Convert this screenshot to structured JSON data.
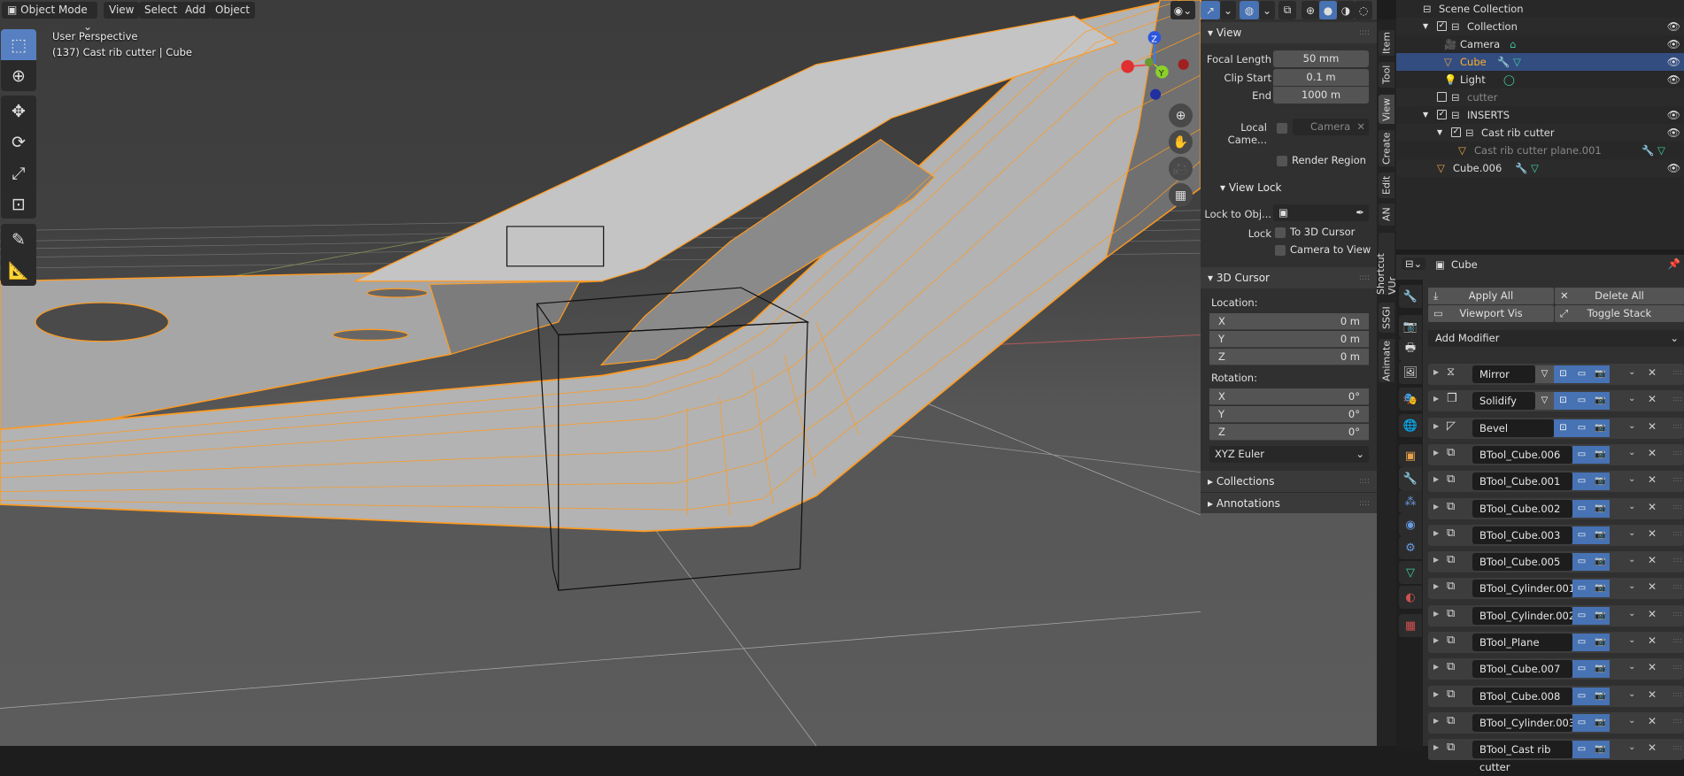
{
  "colors": {
    "accent": "#4772b3",
    "selection": "#334d80",
    "wire": "#ff9a1f",
    "active_object": "#e8a14a"
  },
  "viewport": {
    "header": {
      "mode": "Object Mode",
      "menus": [
        "View",
        "Select",
        "Add",
        "Object"
      ]
    },
    "overlay": {
      "line1": "User Perspective",
      "line2": "(137) Cast rib cutter | Cube"
    },
    "gizmo": {
      "z": "Z",
      "y": "Y"
    },
    "tools": [
      "select-box",
      "cursor",
      "move",
      "rotate",
      "scale",
      "transform",
      "annotate",
      "measure"
    ],
    "header_icons": [
      "visibility",
      "gizmo",
      "overlays",
      "xray",
      "shading-wireframe",
      "shading-solid",
      "shading-material",
      "shading-rendered"
    ]
  },
  "npanel": {
    "view": {
      "title": "View",
      "focal_length_label": "Focal Length",
      "focal_length": "50 mm",
      "clip_start_label": "Clip Start",
      "clip_start": "0.1 m",
      "end_label": "End",
      "end": "1000 m",
      "local_camera_label": "Local Came...",
      "camera_placeholder": "Camera",
      "render_region": "Render Region"
    },
    "view_lock": {
      "title": "View Lock",
      "lock_to_obj_label": "Lock to Obj...",
      "lock_label": "Lock",
      "to_3d_cursor": "To 3D Cursor",
      "camera_to_view": "Camera to View"
    },
    "cursor": {
      "title": "3D Cursor",
      "location_label": "Location:",
      "loc": [
        [
          "X",
          "0 m"
        ],
        [
          "Y",
          "0 m"
        ],
        [
          "Z",
          "0 m"
        ]
      ],
      "rotation_label": "Rotation:",
      "rot": [
        [
          "X",
          "0°"
        ],
        [
          "Y",
          "0°"
        ],
        [
          "Z",
          "0°"
        ]
      ],
      "rotation_mode": "XYZ Euler"
    },
    "collections": "Collections",
    "annotations": "Annotations",
    "tabs": [
      "Item",
      "Tool",
      "View",
      "Create",
      "Edit",
      "AN",
      "Shortcut VUr",
      "SSGI",
      "Animate"
    ],
    "active_tab": "View"
  },
  "outliner": {
    "items": [
      {
        "label": "Scene Collection",
        "indent": 0,
        "icon": "collection",
        "checkbox": null,
        "eye": false
      },
      {
        "label": "Collection",
        "indent": 1,
        "icon": "collection",
        "checkbox": true,
        "eye": true,
        "expanded": true
      },
      {
        "label": "Camera",
        "indent": 2,
        "icon": "camera",
        "eye": true,
        "extra": [
          "camera-data"
        ]
      },
      {
        "label": "Cube",
        "indent": 2,
        "icon": "mesh",
        "eye": true,
        "selected": true,
        "extra": [
          "modifier",
          "mesh-data"
        ]
      },
      {
        "label": "Light",
        "indent": 2,
        "icon": "light",
        "eye": true,
        "extra": [
          "light-data"
        ]
      },
      {
        "label": "cutter",
        "indent": 1,
        "icon": "collection",
        "checkbox": false,
        "eye": false,
        "dim": true
      },
      {
        "label": "INSERTS",
        "indent": 1,
        "icon": "collection",
        "checkbox": true,
        "eye": true,
        "expanded": true
      },
      {
        "label": "Cast rib cutter",
        "indent": 2,
        "icon": "collection",
        "checkbox": true,
        "eye": true,
        "expanded": true
      },
      {
        "label": "Cast rib cutter plane.001",
        "indent": 3,
        "icon": "mesh",
        "eye": false,
        "dim": true,
        "extra": [
          "modifier",
          "mesh-data"
        ]
      },
      {
        "label": "Cube.006",
        "indent": 1,
        "icon": "mesh",
        "eye": true,
        "extra": [
          "modifier",
          "mesh-data"
        ]
      }
    ]
  },
  "properties": {
    "object_name": "Cube",
    "apply_all": "Apply All",
    "delete_all": "Delete All",
    "viewport_vis": "Viewport Vis",
    "toggle_stack": "Toggle Stack",
    "add_modifier": "Add Modifier",
    "tabs": [
      "tool",
      "render",
      "output",
      "view-layer",
      "scene",
      "world",
      "object",
      "modifiers",
      "particles",
      "physics",
      "constraints",
      "data",
      "material",
      "texture"
    ],
    "active_tab": "modifiers",
    "modifiers": [
      {
        "name": "Mirror",
        "icon": "mirror",
        "buttons": [
          "editmode-mesh",
          "editmode",
          "viewport",
          "render"
        ]
      },
      {
        "name": "Solidify",
        "icon": "solidify",
        "buttons": [
          "editmode-mesh",
          "editmode",
          "viewport",
          "render"
        ]
      },
      {
        "name": "Bevel",
        "icon": "bevel",
        "buttons": [
          "editmode",
          "viewport",
          "render"
        ]
      },
      {
        "name": "BTool_Cube.006",
        "icon": "boolean",
        "buttons": [
          "viewport",
          "render"
        ]
      },
      {
        "name": "BTool_Cube.001",
        "icon": "boolean",
        "buttons": [
          "viewport",
          "render"
        ]
      },
      {
        "name": "BTool_Cube.002",
        "icon": "boolean",
        "buttons": [
          "viewport",
          "render"
        ]
      },
      {
        "name": "BTool_Cube.003",
        "icon": "boolean",
        "buttons": [
          "viewport",
          "render"
        ]
      },
      {
        "name": "BTool_Cube.005",
        "icon": "boolean",
        "buttons": [
          "viewport",
          "render"
        ]
      },
      {
        "name": "BTool_Cylinder.001",
        "icon": "boolean",
        "buttons": [
          "viewport",
          "render"
        ]
      },
      {
        "name": "BTool_Cylinder.002",
        "icon": "boolean",
        "buttons": [
          "viewport",
          "render"
        ]
      },
      {
        "name": "BTool_Plane",
        "icon": "boolean",
        "buttons": [
          "viewport",
          "render"
        ]
      },
      {
        "name": "BTool_Cube.007",
        "icon": "boolean",
        "buttons": [
          "viewport",
          "render"
        ]
      },
      {
        "name": "BTool_Cube.008",
        "icon": "boolean",
        "buttons": [
          "viewport",
          "render"
        ]
      },
      {
        "name": "BTool_Cylinder.003",
        "icon": "boolean",
        "buttons": [
          "viewport",
          "render"
        ]
      },
      {
        "name": "BTool_Cast rib cutter",
        "icon": "boolean",
        "buttons": [
          "viewport",
          "render"
        ]
      }
    ]
  }
}
